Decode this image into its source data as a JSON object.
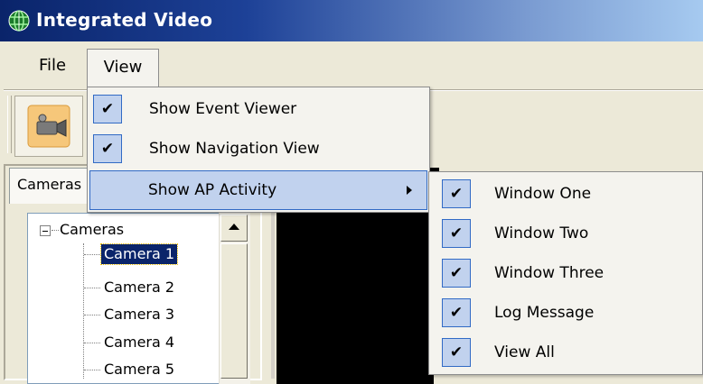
{
  "window": {
    "title": "Integrated Video"
  },
  "menubar": {
    "file": "File",
    "view": "View"
  },
  "view_menu": {
    "items": [
      {
        "label": "Show Event Viewer",
        "checked": true
      },
      {
        "label": "Show Navigation View",
        "checked": true
      },
      {
        "label": "Show AP Activity",
        "checked": false,
        "has_submenu": true,
        "highlighted": true
      }
    ]
  },
  "submenu": {
    "items": [
      {
        "label": "Window One",
        "checked": true
      },
      {
        "label": "Window Two",
        "checked": true
      },
      {
        "label": "Window Three",
        "checked": true
      },
      {
        "label": "Log Message",
        "checked": true
      },
      {
        "label": "View All",
        "checked": true
      }
    ]
  },
  "left_pane": {
    "tab_label": "Cameras",
    "tree": {
      "root": "Cameras",
      "nodes": [
        "Camera 1",
        "Camera 2",
        "Camera 3",
        "Camera 4",
        "Camera 5"
      ],
      "selected": "Camera 1"
    }
  },
  "icons": {
    "check": "✔",
    "app": "globe-icon",
    "toolbar": "video-camera-icon"
  },
  "colors": {
    "highlight": "#c1d2ee",
    "highlight_border": "#316ac5",
    "selection": "#0a246a"
  }
}
